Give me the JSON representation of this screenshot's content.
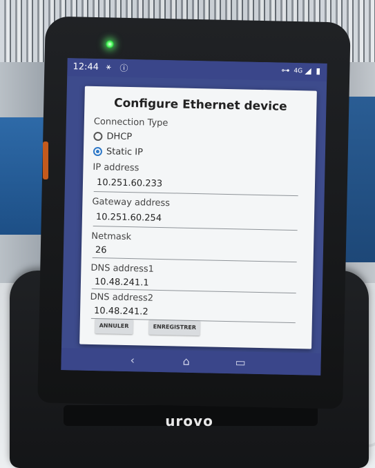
{
  "status_bar": {
    "time": "12:44",
    "network": "4G"
  },
  "dialog": {
    "title": "Configure Ethernet device",
    "connection_type_label": "Connection Type",
    "options": [
      {
        "label": "DHCP",
        "selected": false
      },
      {
        "label": "Static IP",
        "selected": true
      }
    ],
    "fields": [
      {
        "label": "IP address",
        "value": "10.251.60.233"
      },
      {
        "label": "Gateway address",
        "value": "10.251.60.254"
      },
      {
        "label": "Netmask",
        "value": "26"
      },
      {
        "label": "DNS address1",
        "value": "10.48.241.1"
      },
      {
        "label": "DNS address2",
        "value": "10.48.241.2"
      }
    ],
    "buttons": {
      "cancel": "ANNULER",
      "save": "ENREGISTRER"
    }
  },
  "device": {
    "brand": "urovo"
  },
  "colors": {
    "accent": "#2d78c8",
    "status_bar": "#3a468a",
    "dialog_bg": "#f4f6f7"
  }
}
